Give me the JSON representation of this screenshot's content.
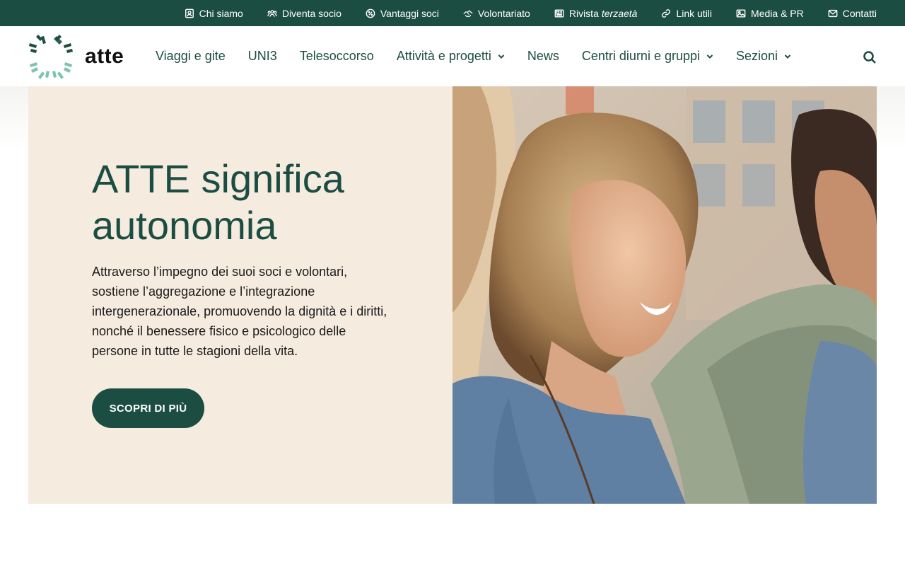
{
  "topbar": {
    "items": [
      {
        "label": "Chi siamo",
        "icon": "person-badge-icon"
      },
      {
        "label": "Diventa socio",
        "icon": "group-icon"
      },
      {
        "label": "Vantaggi soci",
        "icon": "percent-badge-icon"
      },
      {
        "label": "Volontariato",
        "icon": "handshake-icon"
      },
      {
        "label": "Rivista",
        "label_em": "terzaetà",
        "icon": "newspaper-icon"
      },
      {
        "label": "Link utili",
        "icon": "link-icon"
      },
      {
        "label": "Media & PR",
        "icon": "image-icon"
      },
      {
        "label": "Contatti",
        "icon": "mail-icon"
      }
    ]
  },
  "header": {
    "logo_text": "atte",
    "nav": [
      {
        "label": "Viaggi e gite",
        "dropdown": false
      },
      {
        "label": "UNI3",
        "dropdown": false
      },
      {
        "label": "Telesoccorso",
        "dropdown": false
      },
      {
        "label": "Attività e progetti",
        "dropdown": true
      },
      {
        "label": "News",
        "dropdown": false
      },
      {
        "label": "Centri diurni e gruppi",
        "dropdown": true
      },
      {
        "label": "Sezioni",
        "dropdown": true
      }
    ],
    "search_icon": "search-icon"
  },
  "hero": {
    "title_line1": "ATTE significa",
    "title_line2": "autonomia",
    "text": "Attraverso l’impegno dei suoi soci e volontari, sostiene l’aggregazione e l’integrazione intergenerazionale, promuovendo la dignità e i diritti, nonché il benessere fisico e psicologico delle persone in tutte le stagioni della vita.",
    "button_label": "SCOPRI DI PIÙ"
  },
  "colors": {
    "brand_green": "#1c4d42",
    "hero_bg": "#f5ebdf",
    "logo_light": "#7cc4b0"
  }
}
